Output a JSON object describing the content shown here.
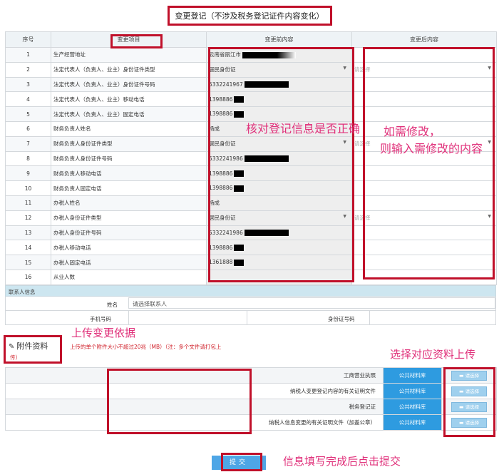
{
  "page_title": "变更登记（不涉及税务登记证件内容变化）",
  "table": {
    "headers": {
      "seq": "序号",
      "item": "变更项目",
      "before": "变更前内容",
      "after": "变更后内容"
    },
    "rows": [
      {
        "seq": "1",
        "item": "生产经营地址",
        "old": "云南省丽江市",
        "old_type": "text",
        "new": "",
        "new_type": "text"
      },
      {
        "seq": "2",
        "item": "法定代表人（负责人、业主）身份证件类型",
        "old": "居民身份证",
        "old_type": "select",
        "new": "请选择",
        "new_type": "select"
      },
      {
        "seq": "3",
        "item": "法定代表人（负责人、业主）身份证件号码",
        "old": "5332241967",
        "old_type": "text",
        "new": "",
        "new_type": "text"
      },
      {
        "seq": "4",
        "item": "法定代表人（负责人、业主）移动电话",
        "old": "1398886",
        "old_type": "text",
        "new": "",
        "new_type": "text"
      },
      {
        "seq": "5",
        "item": "法定代表人（负责人、业主）固定电话",
        "old": "1398886",
        "old_type": "text",
        "new": "",
        "new_type": "text"
      },
      {
        "seq": "6",
        "item": "财务负责人姓名",
        "old": "杨成",
        "old_type": "text",
        "new": "",
        "new_type": "text"
      },
      {
        "seq": "7",
        "item": "财务负责人身份证件类型",
        "old": "居民身份证",
        "old_type": "select",
        "new": "请选择",
        "new_type": "select"
      },
      {
        "seq": "8",
        "item": "财务负责人身份证件号码",
        "old": "5332241986",
        "old_type": "text",
        "new": "",
        "new_type": "text"
      },
      {
        "seq": "9",
        "item": "财务负责人移动电话",
        "old": "1398886",
        "old_type": "text",
        "new": "",
        "new_type": "text"
      },
      {
        "seq": "10",
        "item": "财务负责人固定电话",
        "old": "1398886",
        "old_type": "text",
        "new": "",
        "new_type": "text"
      },
      {
        "seq": "11",
        "item": "办税人姓名",
        "old": "杨成",
        "old_type": "text",
        "new": "",
        "new_type": "text"
      },
      {
        "seq": "12",
        "item": "办税人身份证件类型",
        "old": "居民身份证",
        "old_type": "select",
        "new": "请选择",
        "new_type": "select"
      },
      {
        "seq": "13",
        "item": "办税人身份证件号码",
        "old": "5332241986",
        "old_type": "text",
        "new": "",
        "new_type": "text"
      },
      {
        "seq": "14",
        "item": "办税人移动电话",
        "old": "1398886",
        "old_type": "text",
        "new": "",
        "new_type": "text"
      },
      {
        "seq": "15",
        "item": "办税人固定电话",
        "old": "1361888",
        "old_type": "text",
        "new": "",
        "new_type": "text"
      },
      {
        "seq": "16",
        "item": "从业人数",
        "old": "",
        "old_type": "text",
        "new": "",
        "new_type": "text"
      }
    ]
  },
  "contact": {
    "header": "联系人信息",
    "name_label": "姓名",
    "name_value": "请选择联系人",
    "phone_label": "手机号码",
    "id_label": "身份证号码"
  },
  "attachments": {
    "title": "附件资料",
    "note_line1": "上传的单个附件大小不超过20兆（MB）（注：多个文件请打包上",
    "note_line2": "传）",
    "library_label": "公共材料库",
    "pick_label": "请选择",
    "files": [
      "工商营业执照",
      "纳税人变更登记内容的有关证明文件",
      "税务登记证",
      "纳税人信息变更的有关证明文件（加盖公章）"
    ]
  },
  "submit_label": "提交",
  "annotations": {
    "check": "核对登记信息是否正确",
    "modify_1": "如需修改，",
    "modify_2": "则输入需修改的内容",
    "upload": "上传变更依据",
    "choose": "选择对应资料上传",
    "submit_hint": "信息填写完成后点击提交"
  },
  "colors": {
    "annotation_red": "#c0102a",
    "annotation_pink": "#e0307a",
    "button_blue": "#2e9be0",
    "contact_header_bg": "#cde6f0"
  }
}
